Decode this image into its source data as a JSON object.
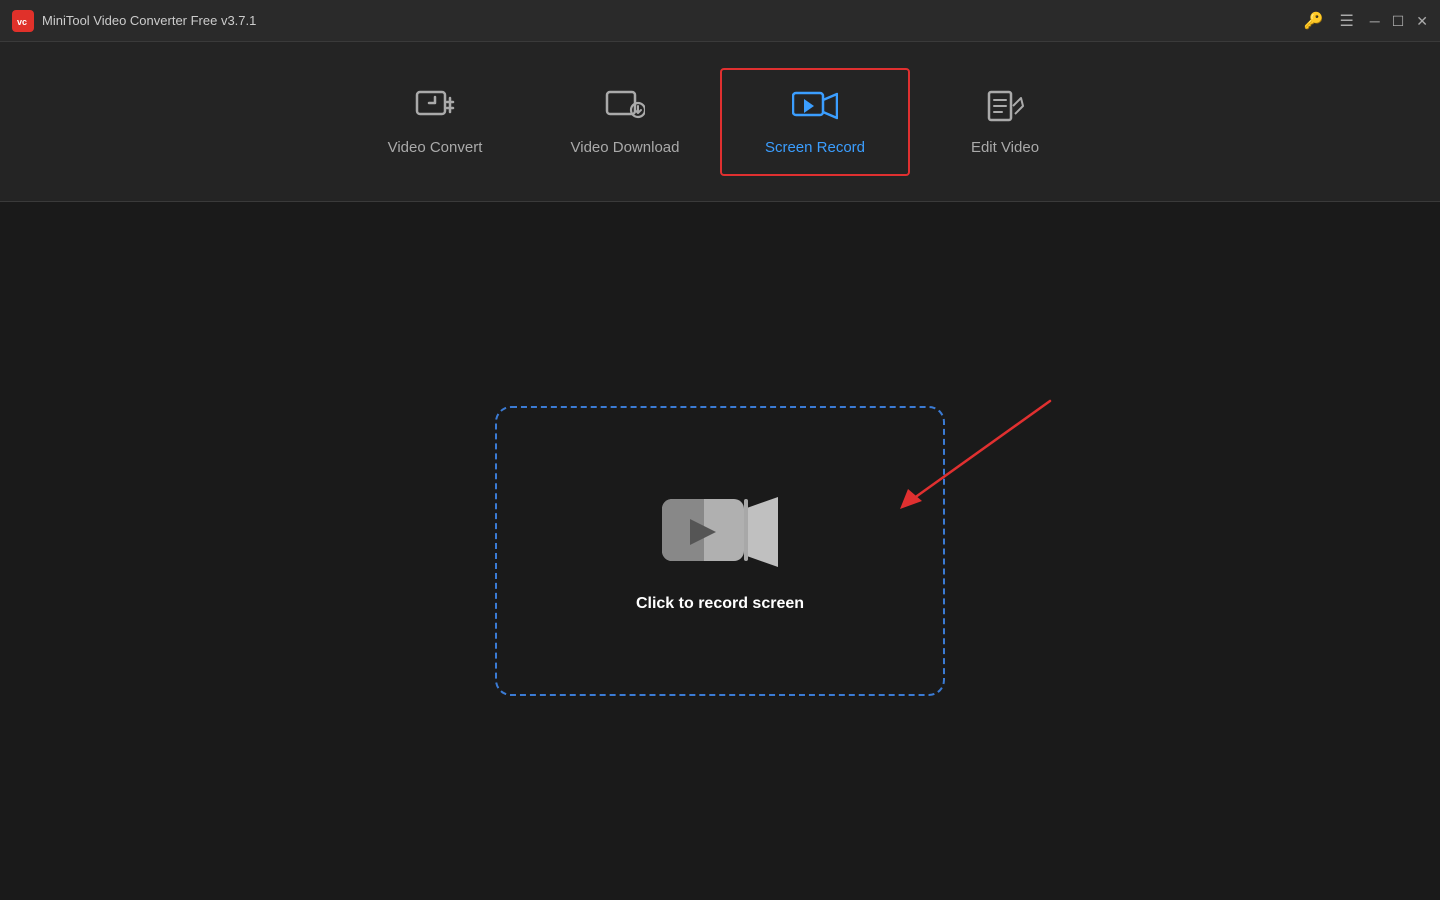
{
  "titleBar": {
    "appName": "MiniTool Video Converter Free v3.7.1",
    "logoText": "vc"
  },
  "nav": {
    "tabs": [
      {
        "id": "video-convert",
        "label": "Video Convert",
        "icon": "convert",
        "active": false
      },
      {
        "id": "video-download",
        "label": "Video Download",
        "icon": "download",
        "active": false
      },
      {
        "id": "screen-record",
        "label": "Screen Record",
        "icon": "record",
        "active": true
      },
      {
        "id": "edit-video",
        "label": "Edit Video",
        "icon": "edit",
        "active": false
      }
    ]
  },
  "mainContent": {
    "recordArea": {
      "label": "Click to record screen"
    }
  },
  "colors": {
    "accent": "#3b9eff",
    "activeBorder": "#e03030",
    "arrowRed": "#e03030",
    "background": "#1a1a1a",
    "navBackground": "#242424",
    "titleBackground": "#2a2a2a"
  }
}
